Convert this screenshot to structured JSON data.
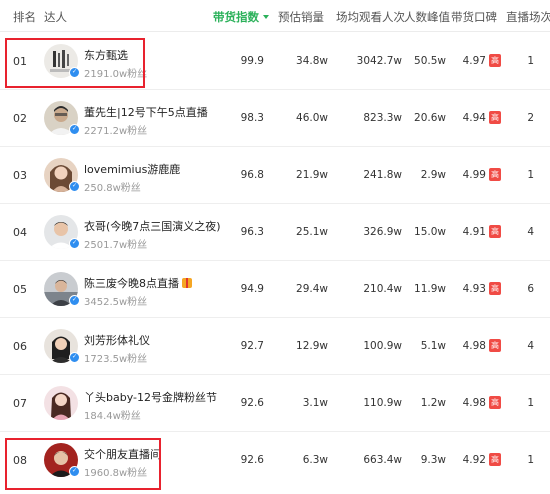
{
  "header": {
    "rank": "排名",
    "streamer": "达人",
    "index": "带货指数",
    "sales": "预估销量",
    "views": "场均观看人次",
    "peak": "人数峰值",
    "reputation": "带货口碑",
    "count": "直播场次"
  },
  "colors": {
    "accent": "#2bb15a",
    "badge": "#f04b45",
    "highlight": "#e8222e",
    "verified": "#2f8ef0"
  },
  "rows": [
    {
      "rank": "01",
      "name": "东方甄选",
      "fans": "2191.0w粉丝",
      "index": "99.9",
      "sales": "34.8w",
      "views": "3042.7w",
      "peak": "50.5w",
      "reputation": "4.97",
      "badge": "高",
      "count": "1"
    },
    {
      "rank": "02",
      "name": "董先生|12号下午5点直播",
      "fans": "2271.2w粉丝",
      "index": "98.3",
      "sales": "46.0w",
      "views": "823.3w",
      "peak": "20.6w",
      "reputation": "4.94",
      "badge": "高",
      "count": "2"
    },
    {
      "rank": "03",
      "name": "lovemimius游鹿鹿",
      "fans": "250.8w粉丝",
      "index": "96.8",
      "sales": "21.9w",
      "views": "241.8w",
      "peak": "2.9w",
      "reputation": "4.99",
      "badge": "高",
      "count": "1"
    },
    {
      "rank": "04",
      "name": "衣哥(今晚7点三国演义之夜)",
      "fans": "2501.7w粉丝",
      "index": "96.3",
      "sales": "25.1w",
      "views": "326.9w",
      "peak": "15.0w",
      "reputation": "4.91",
      "badge": "高",
      "count": "4"
    },
    {
      "rank": "05",
      "name": "陈三废今晚8点直播",
      "fans": "3452.5w粉丝",
      "index": "94.9",
      "sales": "29.4w",
      "views": "210.4w",
      "peak": "11.9w",
      "reputation": "4.93",
      "badge": "高",
      "count": "6"
    },
    {
      "rank": "06",
      "name": "刘芳形体礼仪",
      "fans": "1723.5w粉丝",
      "index": "92.7",
      "sales": "12.9w",
      "views": "100.9w",
      "peak": "5.1w",
      "reputation": "4.98",
      "badge": "高",
      "count": "4"
    },
    {
      "rank": "07",
      "name": "丫头baby-12号金牌粉丝节",
      "fans": "184.4w粉丝",
      "index": "92.6",
      "sales": "3.1w",
      "views": "110.9w",
      "peak": "1.2w",
      "reputation": "4.98",
      "badge": "高",
      "count": "1"
    },
    {
      "rank": "08",
      "name": "交个朋友直播间",
      "fans": "1960.8w粉丝",
      "index": "92.6",
      "sales": "6.3w",
      "views": "663.4w",
      "peak": "9.3w",
      "reputation": "4.92",
      "badge": "高",
      "count": "1"
    }
  ]
}
